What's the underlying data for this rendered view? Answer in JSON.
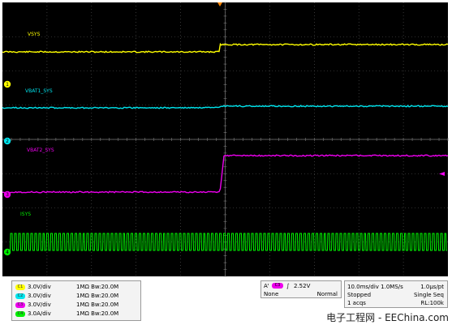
{
  "traces": [
    {
      "label": "VSYS",
      "marker": "1",
      "color": "#ffff00"
    },
    {
      "label": "VBAT1_SYS",
      "marker": "2",
      "color": "#00e5ee"
    },
    {
      "label": "VBAT2_SYS",
      "marker": "3",
      "color": "#ee00ee"
    },
    {
      "label": "ISYS",
      "marker": "4",
      "color": "#00ee00"
    }
  ],
  "channels": [
    {
      "badge": "C1",
      "scale": "3.0V/div",
      "impedance": "1MΩ",
      "bw": "Bw:20.0M",
      "color": "#ffff00"
    },
    {
      "badge": "C2",
      "scale": "3.0V/div",
      "impedance": "1MΩ",
      "bw": "Bw:20.0M",
      "color": "#00e5ee"
    },
    {
      "badge": "C3",
      "scale": "3.0V/div",
      "impedance": "1MΩ",
      "bw": "Bw:20.0M",
      "color": "#ee00ee"
    },
    {
      "badge": "C4",
      "scale": "3.0A/div",
      "impedance": "1MΩ",
      "bw": "Bw:20.0M",
      "color": "#00ee00"
    }
  ],
  "trigger": {
    "prefix": "A'",
    "source": "C3",
    "level": "2.52V",
    "mode_left": "None",
    "mode_right": "Normal"
  },
  "timebase": {
    "line1_left": "10.0ms/div 1.0MS/s",
    "line1_right": "1.0µs/pt",
    "line2_left": "Stopped",
    "line2_right": "Single Seq",
    "line3_left": "1 acqs",
    "line3_right": "RL:100k"
  },
  "watermark": "电子工程网 - EEChina.com",
  "colors": {
    "grid": "#5a5a5a",
    "screen": "#000000",
    "ref": "#ff8800"
  }
}
